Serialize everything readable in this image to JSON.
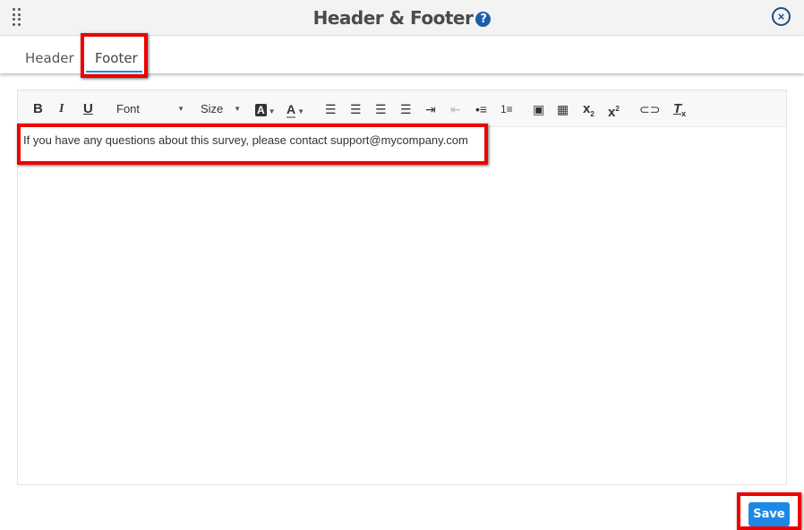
{
  "dialog": {
    "title": "Header & Footer",
    "help_icon": "question-circle-icon",
    "close_icon": "close-circle-icon"
  },
  "tabs": [
    {
      "label": "Header",
      "active": false
    },
    {
      "label": "Footer",
      "active": true
    }
  ],
  "toolbar": {
    "bold": "B",
    "italic": "I",
    "underline": "U",
    "font": "Font",
    "size": "Size",
    "bg_color": "A",
    "text_color": "A"
  },
  "editor": {
    "content": "If you have any questions about this survey, please contact support@mycompany.com"
  },
  "save_label": "Save",
  "colors": {
    "accent": "#1e88e5",
    "annotation": "#ee0000"
  }
}
